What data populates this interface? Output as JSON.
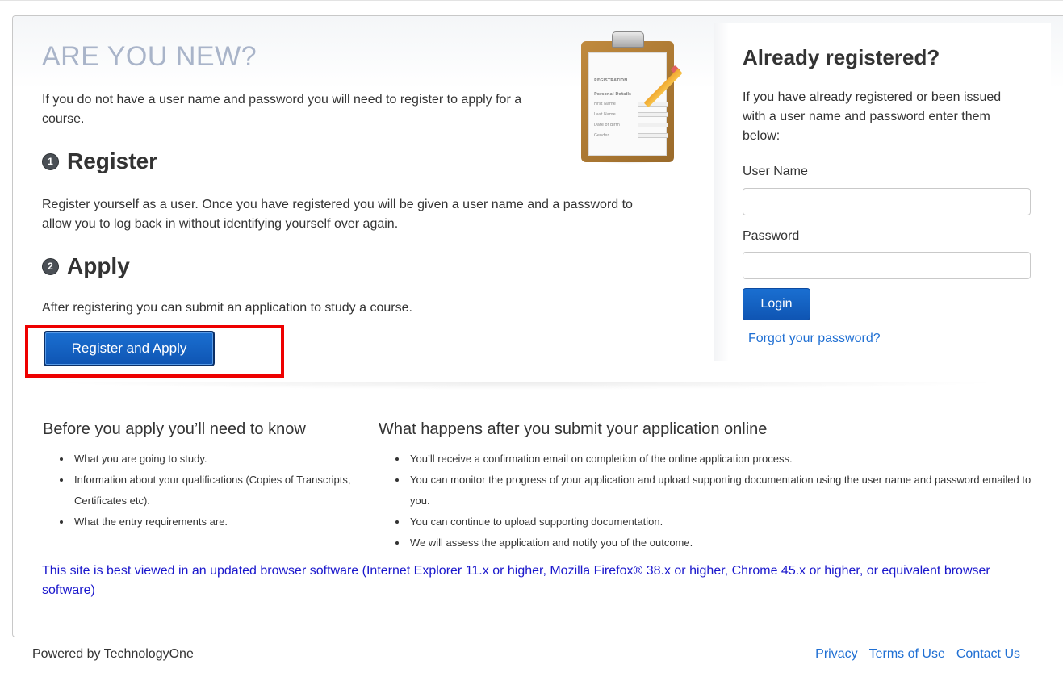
{
  "new_section": {
    "title": "ARE YOU NEW?",
    "intro": "If you do not have a user name and password you will need to register to apply for a course.",
    "step1": {
      "number": "1",
      "title": "Register",
      "text": "Register yourself as a user. Once you have registered you will be given a user name and a password to allow you to log back in without identifying yourself over again."
    },
    "step2": {
      "number": "2",
      "title": "Apply",
      "text": "After registering you can submit an application to study a course."
    },
    "register_button": "Register and Apply"
  },
  "illustration": {
    "header": "REGISTRATION",
    "subheader": "Personal Details",
    "fields": [
      "First Name",
      "Last Name",
      "Date of Birth",
      "Gender"
    ]
  },
  "login": {
    "title": "Already registered?",
    "intro": "If you have already registered or been issued with a user name and password enter them below:",
    "username_label": "User Name",
    "username_value": "",
    "password_label": "Password",
    "password_value": "",
    "login_button": "Login",
    "forgot_link": "Forgot your password?"
  },
  "info": {
    "before_heading": "Before you apply you’ll need to know",
    "before_items": [
      "What you are going to study.",
      "Information about your qualifications (Copies of Transcripts, Certificates etc).",
      "What the entry requirements are."
    ],
    "after_heading": "What happens after you submit your application online",
    "after_items": [
      "You’ll receive a confirmation email on completion of the online application process.",
      "You can monitor the progress of your application and upload supporting documentation using the user name and password emailed to you.",
      "You can continue to upload supporting documentation.",
      "We will assess the application and notify you of the outcome."
    ],
    "browser_note": "This site is best viewed in an updated browser software (Internet Explorer 11.x or higher, Mozilla Firefox® 38.x or higher, Chrome 45.x or higher, or equivalent browser software)"
  },
  "footer": {
    "powered_by": "Powered by TechnologyOne",
    "links": [
      "Privacy",
      "Terms of Use",
      "Contact Us"
    ]
  },
  "colors": {
    "accent_blue": "#1060c4",
    "link_blue": "#1f6fd3",
    "highlight_red": "#ee0000",
    "title_gray_blue": "#a9b4c9",
    "note_blue": "#1a17cc"
  }
}
